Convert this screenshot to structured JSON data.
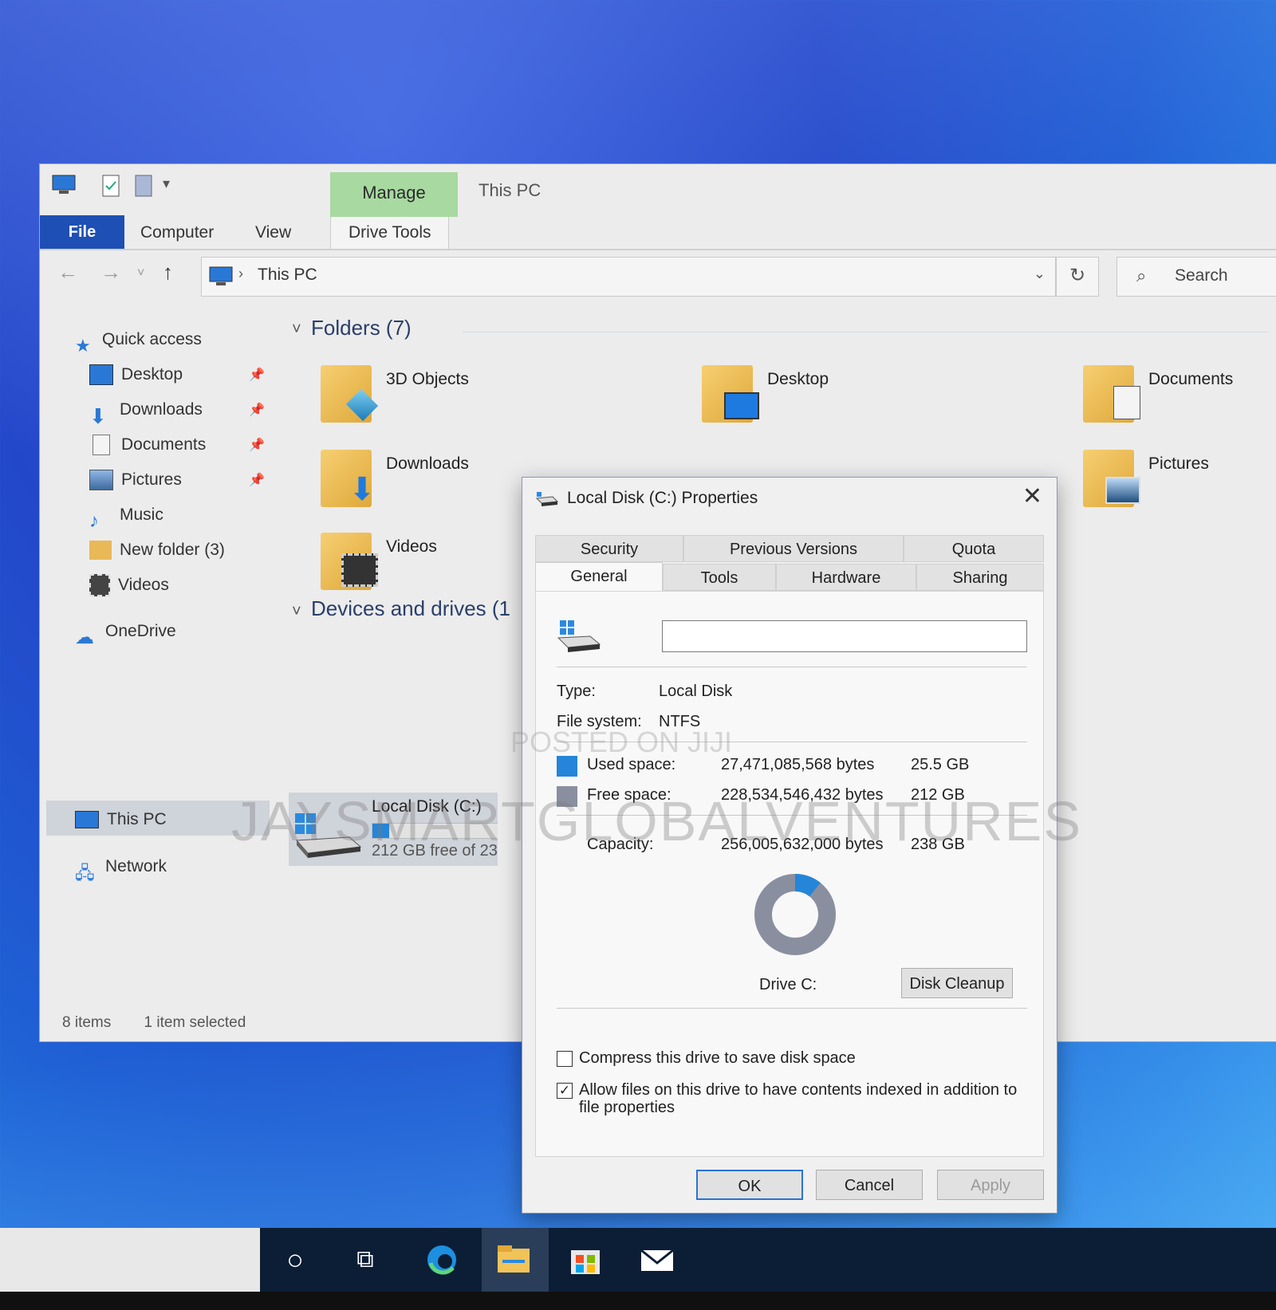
{
  "ribbon": {
    "context_tab": "Manage",
    "window_title": "This PC",
    "tabs": {
      "file": "File",
      "computer": "Computer",
      "view": "View",
      "drive_tools": "Drive Tools"
    }
  },
  "address": {
    "path": "This PC",
    "search_placeholder": "Search"
  },
  "nav": {
    "quick_access": "Quick access",
    "items": [
      "Desktop",
      "Downloads",
      "Documents",
      "Pictures",
      "Music",
      "New folder (3)",
      "Videos"
    ],
    "onedrive": "OneDrive",
    "this_pc": "This PC",
    "network": "Network"
  },
  "content": {
    "folders_header": "Folders (7)",
    "folders": [
      "3D Objects",
      "Desktop",
      "Documents",
      "Downloads",
      "Pictures",
      "Videos"
    ],
    "devices_header": "Devices and drives (1",
    "drive": {
      "label": "Local Disk (C:)",
      "free_text": "212 GB free of 23",
      "used_fraction": 0.107
    }
  },
  "status": {
    "items": "8 items",
    "selected": "1 item selected"
  },
  "dialog": {
    "title": "Local Disk (C:) Properties",
    "tabs_row1": [
      "Security",
      "Previous Versions",
      "Quota"
    ],
    "tabs_row2": [
      "General",
      "Tools",
      "Hardware",
      "Sharing"
    ],
    "name_value": "",
    "type_label": "Type:",
    "type_value": "Local Disk",
    "fs_label": "File system:",
    "fs_value": "NTFS",
    "used_label": "Used space:",
    "used_bytes": "27,471,085,568 bytes",
    "used_gb": "25.5 GB",
    "free_label": "Free space:",
    "free_bytes": "228,534,546,432 bytes",
    "free_gb": "212 GB",
    "capacity_label": "Capacity:",
    "capacity_bytes": "256,005,632,000 bytes",
    "capacity_gb": "238 GB",
    "drive_label": "Drive C:",
    "disk_cleanup": "Disk Cleanup",
    "compress_label": "Compress this drive to save disk space",
    "compress_checked": false,
    "index_label_1": "Allow files on this drive to have contents indexed in addition to",
    "index_label_2": "file properties",
    "index_checked": true,
    "ok": "OK",
    "cancel": "Cancel",
    "apply": "Apply",
    "used_color": "#2585d8",
    "free_color": "#8a8fa0"
  },
  "watermark": {
    "large": "JAYSMARTGLOBALVENTURES",
    "small": "POSTED ON JIJI"
  }
}
